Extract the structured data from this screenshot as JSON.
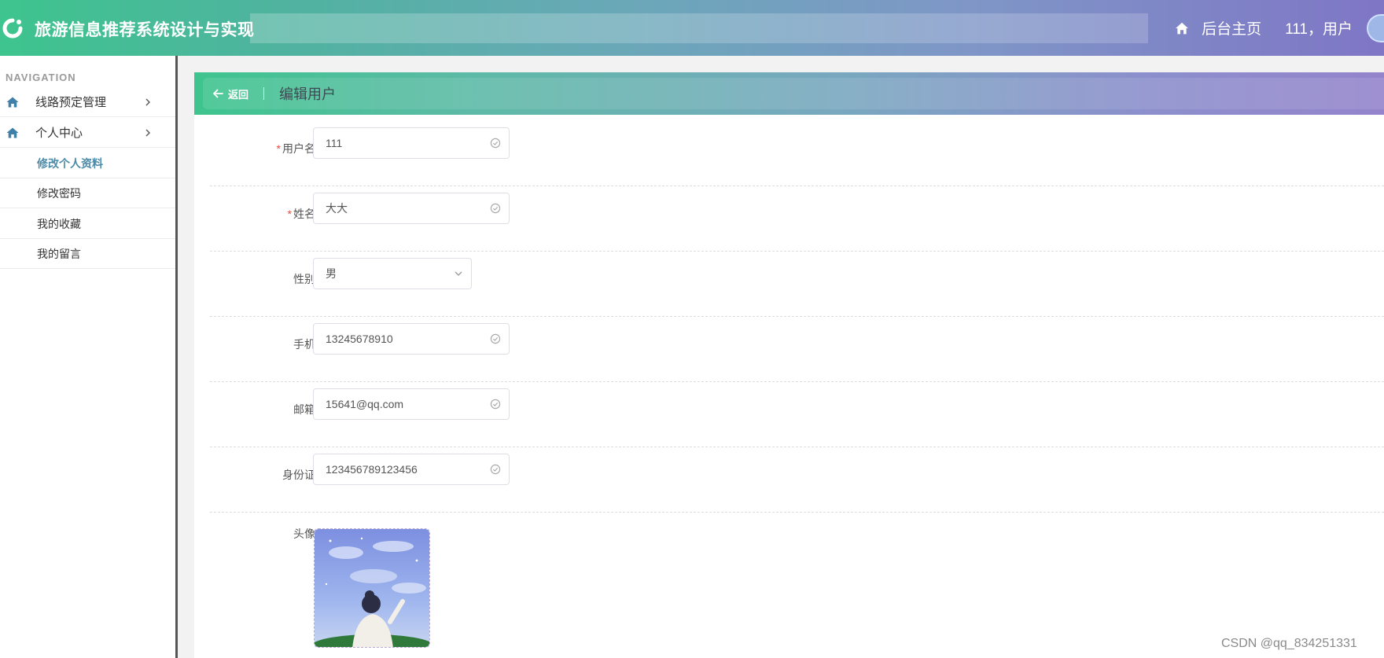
{
  "header": {
    "title": "旅游信息推荐系统设计与实现",
    "search_value": "",
    "home_label": "后台主页",
    "user_label": "111，用户",
    "gradient_start": "#3ec48e",
    "gradient_end": "#7f76c6"
  },
  "sidebar": {
    "caption": "NAVIGATION",
    "menus": [
      {
        "label": "线路预定管理",
        "icon": "home-icon"
      },
      {
        "label": "个人中心",
        "icon": "home-icon"
      }
    ],
    "subitems": [
      {
        "label": "修改个人资料",
        "active": true
      },
      {
        "label": "修改密码",
        "active": false
      },
      {
        "label": "我的收藏",
        "active": false
      },
      {
        "label": "我的留言",
        "active": false
      }
    ],
    "active_color": "#4c8aa8"
  },
  "page_bar": {
    "back_label": "返回",
    "title": "编辑用户"
  },
  "form": {
    "username": {
      "label": "用户名",
      "value": "111",
      "required": true
    },
    "name": {
      "label": "姓名",
      "value": "大大",
      "required": true
    },
    "gender": {
      "label": "性别",
      "value": "男"
    },
    "phone": {
      "label": "手机",
      "value": "13245678910"
    },
    "email": {
      "label": "邮箱",
      "value": "15641@qq.com"
    },
    "idcard": {
      "label": "身份证",
      "value": "123456789123456"
    },
    "avatar": {
      "label": "头像"
    },
    "required_mark": "*"
  },
  "watermark": "CSDN @qq_834251331"
}
